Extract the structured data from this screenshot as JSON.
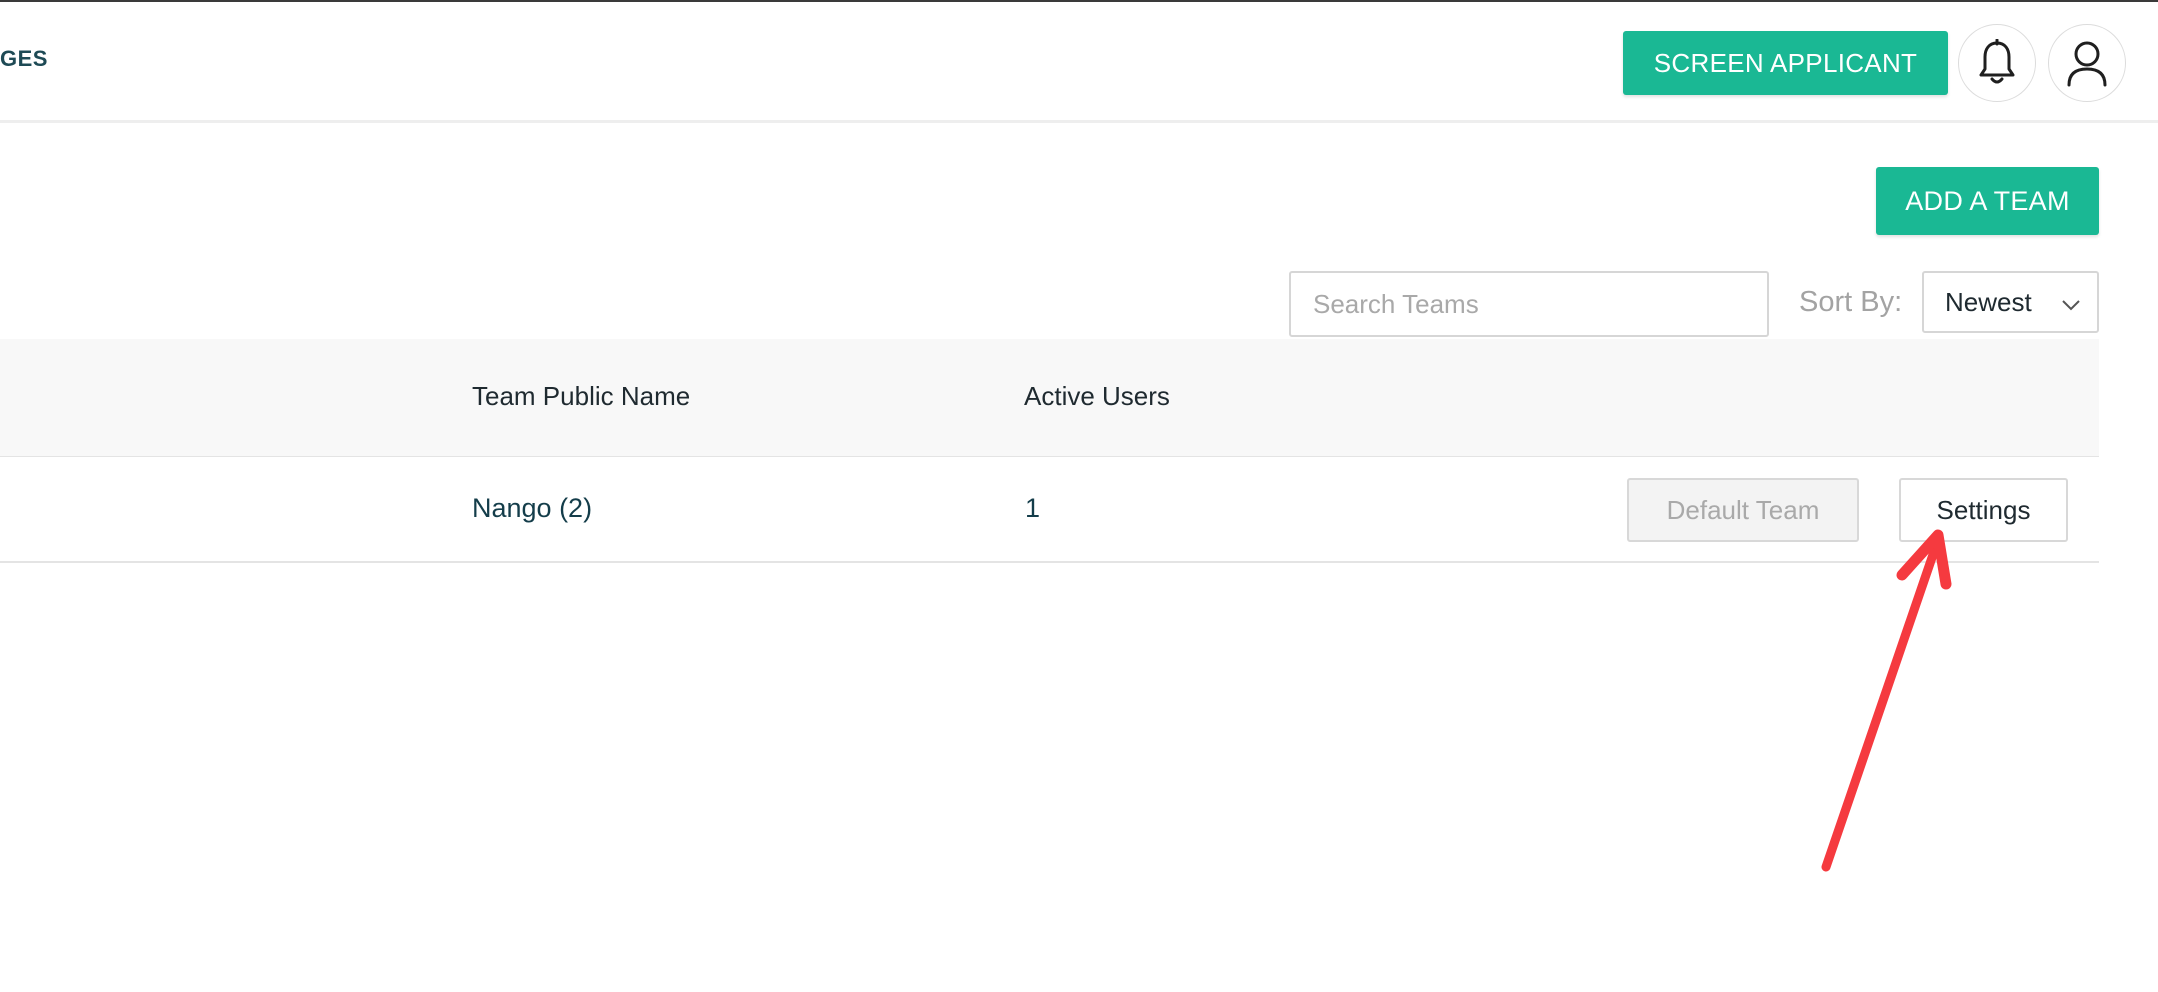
{
  "header": {
    "nav_fragment": "GES",
    "screen_applicant_label": "SCREEN APPLICANT",
    "bell_icon": "bell-icon",
    "user_icon": "user-icon"
  },
  "toolbar": {
    "add_team_label": "ADD A TEAM",
    "search_placeholder": "Search Teams",
    "search_value": "",
    "sort_label": "Sort By:",
    "sort_selected": "Newest"
  },
  "table": {
    "columns": [
      "Team Public Name",
      "Active Users"
    ],
    "rows": [
      {
        "team_public_name": "Nango (2)",
        "active_users": "1",
        "default_team_label": "Default Team",
        "settings_label": "Settings"
      }
    ]
  },
  "annotation": {
    "arrow_color": "#f53a3f",
    "arrow_icon": "red-arrow-annotation"
  },
  "colors": {
    "accent": "#1ab894",
    "text_dark": "#143d4a"
  }
}
